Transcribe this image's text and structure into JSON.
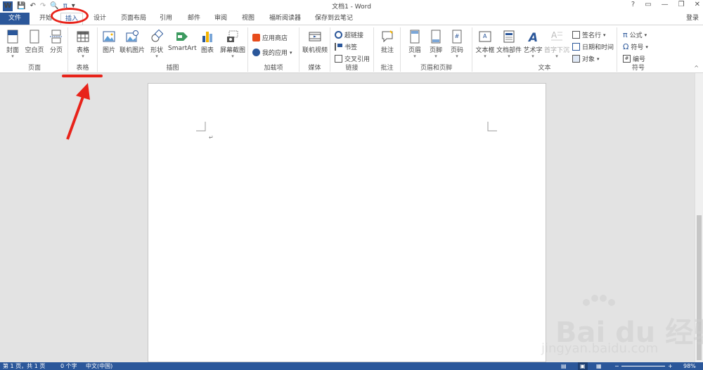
{
  "window": {
    "title": "文档1 - Word",
    "help": "?",
    "min": "—",
    "restore": "❐",
    "close": "✕"
  },
  "qat": {
    "app_icon": "W",
    "save": "💾",
    "undo": "↶",
    "redo": "↷",
    "preview": "🔍",
    "pi": "π",
    "more": "▾"
  },
  "tabs": {
    "file": "文件",
    "home": "开始",
    "insert": "插入",
    "design": "设计",
    "layout": "页面布局",
    "references": "引用",
    "mailings": "邮件",
    "review": "审阅",
    "view": "视图",
    "foxit": "福昕阅读器",
    "cloudnote": "保存到云笔记",
    "signin": "登录"
  },
  "groups": {
    "pages": {
      "label": "页面",
      "cover": "封面",
      "blank": "空白页",
      "pagebreak": "分页"
    },
    "tables": {
      "label": "表格",
      "table": "表格"
    },
    "illustrations": {
      "label": "插图",
      "pictures": "图片",
      "online_pictures": "联机图片",
      "shapes": "形状",
      "smartart": "SmartArt",
      "chart": "图表",
      "screenshot": "屏幕截图"
    },
    "addins": {
      "label": "加载项",
      "store": "应用商店",
      "myapps": "我的应用"
    },
    "media": {
      "label": "媒体",
      "online_video": "联机视频"
    },
    "links": {
      "label": "链接",
      "hyperlink": "超链接",
      "bookmark": "书签",
      "crossref": "交叉引用"
    },
    "comments": {
      "label": "批注",
      "comment": "批注"
    },
    "headerfooter": {
      "label": "页眉和页脚",
      "header": "页眉",
      "footer": "页脚",
      "pagenum": "页码"
    },
    "text": {
      "label": "文本",
      "textbox": "文本框",
      "quickparts": "文档部件",
      "wordart": "艺术字",
      "dropcap": "首字下沉",
      "sigline": "签名行",
      "datetime": "日期和时间",
      "object": "对象"
    },
    "symbols": {
      "label": "符号",
      "equation": "公式",
      "symbol": "符号",
      "number": "编号"
    }
  },
  "document": {
    "para_mark": "↵"
  },
  "status": {
    "page": "第 1 页，共 1 页",
    "words": "0 个字",
    "lang": "中文(中国)",
    "zoom": "98%"
  },
  "watermark": {
    "text": "Bai du 经验",
    "url": "jingyan.baidu.com"
  },
  "colors": {
    "word_blue": "#2b579a",
    "annotation_red": "#e8231a"
  }
}
